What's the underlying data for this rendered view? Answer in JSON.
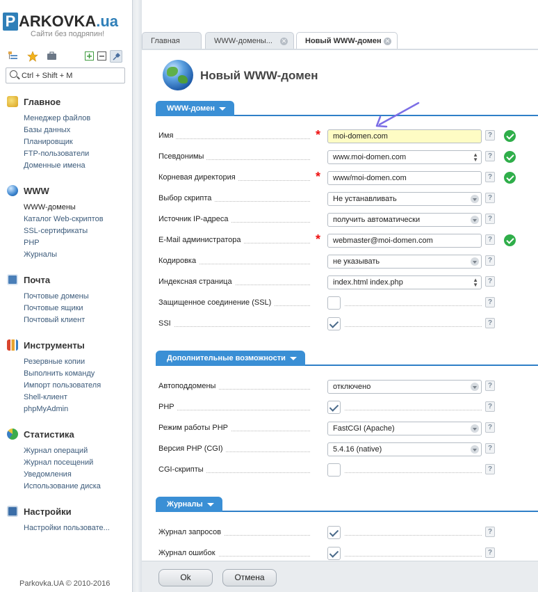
{
  "logo": {
    "p": "P",
    "name_main": "ARKOVKA",
    "name_suffix": ".ua",
    "slogan": "Сайти без подряпин!"
  },
  "sidebar": {
    "search_placeholder": "Ctrl + Shift + M",
    "groups": [
      {
        "title": "Главное",
        "icon": "home-icon",
        "items": [
          "Менеджер файлов",
          "Базы данных",
          "Планировщик",
          "FTP-пользователи",
          "Доменные имена"
        ]
      },
      {
        "title": "WWW",
        "icon": "globe-icon",
        "items": [
          "WWW-домены",
          "Каталог Web-скриптов",
          "SSL-сертификаты",
          "PHP",
          "Журналы"
        ]
      },
      {
        "title": "Почта",
        "icon": "mail-icon",
        "items": [
          "Почтовые домены",
          "Почтовые ящики",
          "Почтовый клиент"
        ]
      },
      {
        "title": "Инструменты",
        "icon": "tools-icon",
        "items": [
          "Резервные копии",
          "Выполнить команду",
          "Импорт пользователя",
          "Shell-клиент",
          "phpMyAdmin"
        ]
      },
      {
        "title": "Статистика",
        "icon": "chart-icon",
        "items": [
          "Журнал операций",
          "Журнал посещений",
          "Уведомления",
          "Использование диска"
        ]
      },
      {
        "title": "Настройки",
        "icon": "settings-icon",
        "items": [
          "Настройки пользовате..."
        ]
      }
    ],
    "copyright": "Parkovka.UA © 2010-2016"
  },
  "tabs": [
    {
      "label": "Главная",
      "closable": false
    },
    {
      "label": "WWW-домены...",
      "closable": true
    },
    {
      "label": "Новый WWW-домен",
      "closable": true,
      "active": true
    }
  ],
  "page_title": "Новый WWW-домен",
  "sections": [
    {
      "title": "WWW-домен",
      "rows": [
        {
          "label": "Имя",
          "required": true,
          "type": "text",
          "value": "moi-domen.com",
          "highlight": true,
          "valid": true
        },
        {
          "label": "Псевдонимы",
          "required": false,
          "type": "spin",
          "value": "www.moi-domen.com",
          "valid": true
        },
        {
          "label": "Корневая директория",
          "required": true,
          "type": "text",
          "value": "www/moi-domen.com",
          "valid": true
        },
        {
          "label": "Выбор скрипта",
          "required": false,
          "type": "select",
          "value": "Не устанавливать"
        },
        {
          "label": "Источник IP-адреса",
          "required": false,
          "type": "select",
          "value": "получить автоматически"
        },
        {
          "label": "E-Mail администратора",
          "required": true,
          "type": "text",
          "value": "webmaster@moi-domen.com",
          "valid": true
        },
        {
          "label": "Кодировка",
          "required": false,
          "type": "select",
          "value": "не указывать"
        },
        {
          "label": "Индексная страница",
          "required": false,
          "type": "spin",
          "value": "index.html index.php"
        },
        {
          "label": "Защищенное соединение (SSL)",
          "required": false,
          "type": "checkbox",
          "checked": false
        },
        {
          "label": "SSI",
          "required": false,
          "type": "checkbox",
          "checked": true
        }
      ]
    },
    {
      "title": "Дополнительные возможности",
      "rows": [
        {
          "label": "Автоподдомены",
          "type": "select",
          "value": "отключено"
        },
        {
          "label": "PHP",
          "type": "checkbox",
          "checked": true
        },
        {
          "label": "Режим работы PHP",
          "type": "select",
          "value": "FastCGI (Apache)"
        },
        {
          "label": "Версия PHP (CGI)",
          "type": "select",
          "value": "5.4.16 (native)"
        },
        {
          "label": "CGI-скрипты",
          "type": "checkbox",
          "checked": false
        }
      ]
    },
    {
      "title": "Журналы",
      "rows": [
        {
          "label": "Журнал запросов",
          "type": "checkbox",
          "checked": true
        },
        {
          "label": "Журнал ошибок",
          "type": "checkbox",
          "checked": true
        }
      ]
    }
  ],
  "buttons": {
    "ok": "Ok",
    "cancel": "Отмена"
  },
  "help_glyph": "?",
  "colors": {
    "accent": "#3a8fd5",
    "valid": "#2fae4a",
    "required": "#e11111",
    "highlight": "#fefcc4"
  }
}
